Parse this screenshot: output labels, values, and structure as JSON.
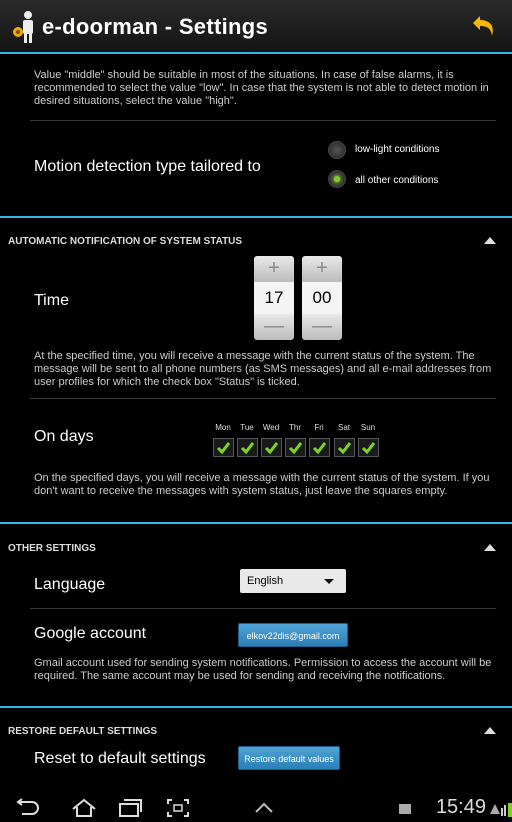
{
  "app": {
    "title": "e-doorman - Settings"
  },
  "motion": {
    "note": "Value \"middle\" should be suitable in most of the situations. In case of false alarms, it is recommended to select the value \"low\". In case that the system is not able to detect motion in desired situations, select the value \"high\".",
    "label": "Motion detection type tailored to",
    "options": [
      {
        "label": "low-light conditions",
        "checked": false
      },
      {
        "label": "all other conditions",
        "checked": true
      }
    ]
  },
  "notification": {
    "header": "AUTOMATIC NOTIFICATION OF SYSTEM STATUS",
    "time_label": "Time",
    "hour": "17",
    "minute": "00",
    "plus": "+",
    "minus": "—",
    "time_note": "At the specified time, you will receive a message with the current status of the system. The message will be sent to all phone numbers (as SMS messages) and all e-mail addresses from user profiles for which the check box \"Status\" is ticked.",
    "days_label": "On days",
    "days": [
      {
        "label": "Mon",
        "checked": true
      },
      {
        "label": "Tue",
        "checked": true
      },
      {
        "label": "Wed",
        "checked": true
      },
      {
        "label": "Thr",
        "checked": true
      },
      {
        "label": "Fri",
        "checked": true
      },
      {
        "label": "Sat",
        "checked": true
      },
      {
        "label": "Sun",
        "checked": true
      }
    ],
    "days_note": "On the specified days, you will receive a message with the current status of the system. If you don't want to receive the messages with system status, just leave the squares empty."
  },
  "other": {
    "header": "OTHER SETTINGS",
    "language_label": "Language",
    "language_value": "English",
    "google_label": "Google account",
    "google_value": "elkov22dis@gmail.com",
    "google_note": "Gmail account used for sending system notifications. Permission to access the account will be required. The same account may be used for sending and receiving the notifications."
  },
  "restore": {
    "header": "RESTORE DEFAULT SETTINGS",
    "label": "Reset to default settings",
    "button": "Restore default values"
  },
  "statusbar": {
    "time": "15:49"
  },
  "colors": {
    "accent": "#33b5e5",
    "check": "#7ed321",
    "button": "#2b7fb8"
  }
}
